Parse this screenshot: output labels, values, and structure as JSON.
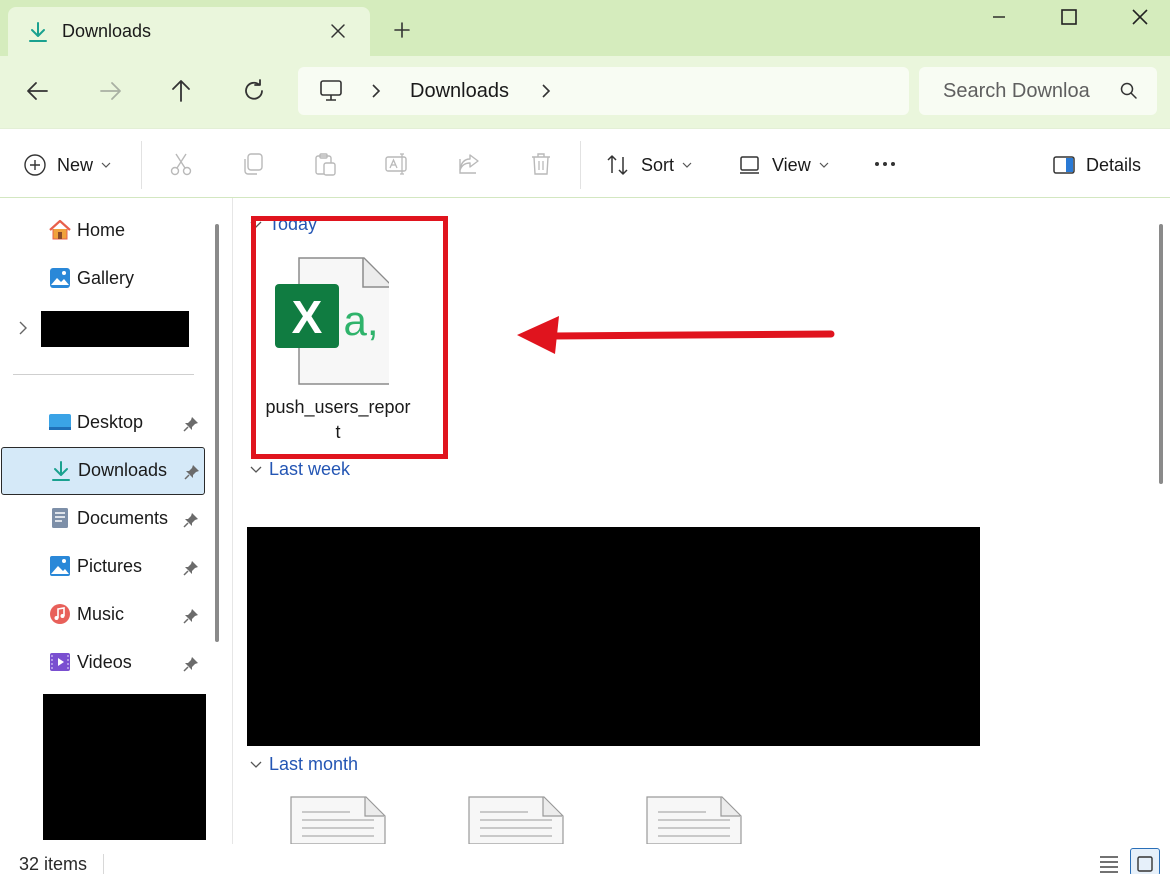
{
  "window": {
    "tab_title": "Downloads",
    "new_tab_icon": "plus-icon"
  },
  "address": {
    "crumbs": [
      "Downloads"
    ],
    "search_placeholder": "Search Downloa"
  },
  "commands": {
    "new_label": "New",
    "sort_label": "Sort",
    "view_label": "View",
    "details_label": "Details"
  },
  "sidebar": {
    "items": [
      {
        "label": "Home",
        "icon": "home-icon",
        "pinned": false
      },
      {
        "label": "Gallery",
        "icon": "gallery-icon",
        "pinned": false
      },
      {
        "label": "Desktop",
        "icon": "desktop-icon",
        "pinned": true
      },
      {
        "label": "Downloads",
        "icon": "download-icon",
        "pinned": true,
        "selected": true
      },
      {
        "label": "Documents",
        "icon": "documents-icon",
        "pinned": true
      },
      {
        "label": "Pictures",
        "icon": "pictures-icon",
        "pinned": true
      },
      {
        "label": "Music",
        "icon": "music-icon",
        "pinned": true
      },
      {
        "label": "Videos",
        "icon": "videos-icon",
        "pinned": true
      }
    ]
  },
  "content": {
    "groups": [
      {
        "label": "Today"
      },
      {
        "label": "Last week"
      },
      {
        "label": "Last month"
      }
    ],
    "today_file": {
      "name": "push_users_report",
      "icon": "excel-csv-file-icon"
    }
  },
  "status": {
    "item_count": "32 items"
  },
  "colors": {
    "titlebar": "#d5ecbd",
    "toolbar": "#eaf6dc",
    "selection": "#d5e9f8",
    "group_header": "#2456b4",
    "annotation_red": "#e0141e",
    "excel_green": "#107c41"
  }
}
